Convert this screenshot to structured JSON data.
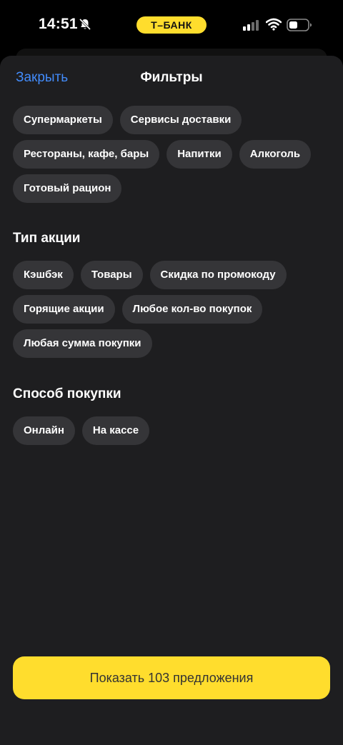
{
  "status_bar": {
    "time": "14:51",
    "bank_label": "Т–БАНК",
    "icons": [
      "bell-slash-icon",
      "signal-icon",
      "wifi-icon",
      "battery-icon"
    ]
  },
  "header": {
    "close_label": "Закрыть",
    "title": "Фильтры"
  },
  "categories": {
    "chips": [
      "Супермаркеты",
      "Сервисы доставки",
      "Рестораны, кафе, бары",
      "Напитки",
      "Алкоголь",
      "Готовый рацион"
    ]
  },
  "promo_type": {
    "title": "Тип акции",
    "chips": [
      "Кэшбэк",
      "Товары",
      "Скидка по промокоду",
      "Горящие акции",
      "Любое кол-во покупок",
      "Любая сумма покупки"
    ]
  },
  "purchase_method": {
    "title": "Способ покупки",
    "chips": [
      "Онлайн",
      "На кассе"
    ]
  },
  "cta": {
    "label": "Показать 103 предложения"
  },
  "colors": {
    "accent_yellow": "#ffdd2d",
    "link_blue": "#428bf9",
    "sheet_bg": "#1e1e20",
    "chip_bg": "#353538"
  }
}
